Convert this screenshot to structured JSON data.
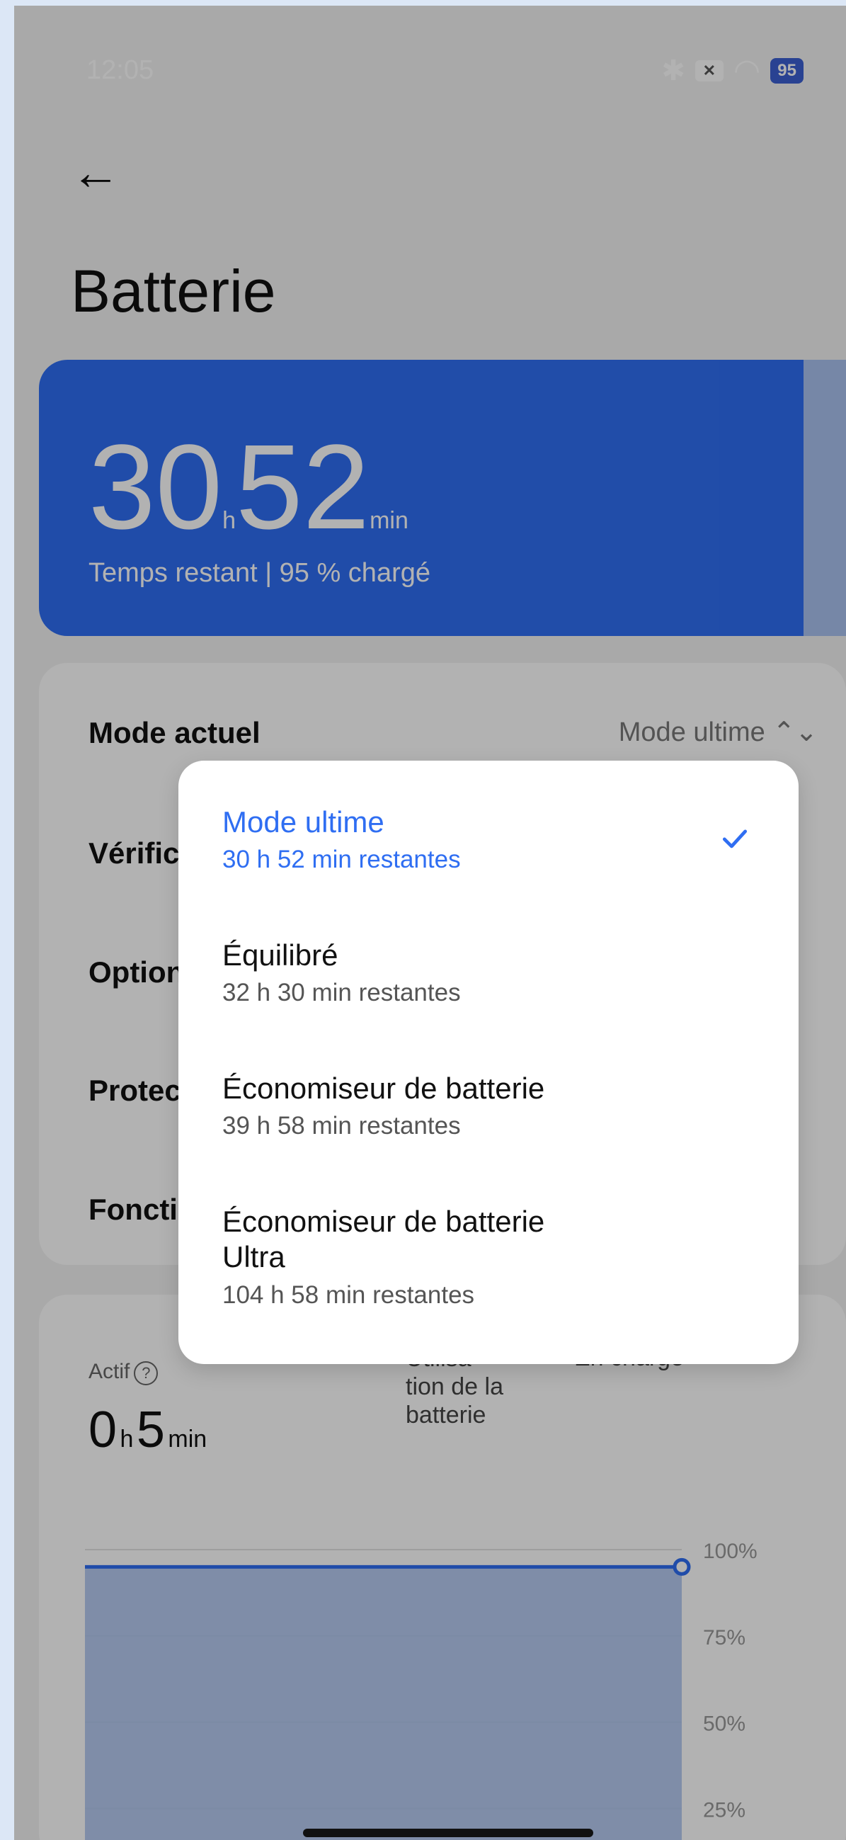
{
  "status_bar": {
    "time": "12:05",
    "battery_level": "95",
    "wifi_sub": "6"
  },
  "header": {
    "title": "Batterie"
  },
  "hero": {
    "hours": "30",
    "hours_unit": "h",
    "minutes": "52",
    "minutes_unit": "min",
    "subtitle": "Temps restant | 95 % chargé"
  },
  "settings": {
    "current_mode_label": "Mode actuel",
    "current_mode_value": "Mode ultime",
    "rows": [
      "Vérific",
      "Option",
      "Protec",
      "Foncti"
    ]
  },
  "usage": {
    "active_label": "Actif",
    "hours": "0",
    "hours_unit": "h",
    "minutes": "5",
    "minutes_unit": "min",
    "legend_usage": "Utilisa\ntion de la\nbatterie",
    "legend_charge": "En charge"
  },
  "chart_data": {
    "type": "area",
    "y_tick_labels": [
      "100%",
      "75%",
      "50%",
      "25%"
    ],
    "ylim": [
      0,
      100
    ],
    "series": [
      {
        "name": "Utilisation de la batterie",
        "values": [
          95,
          95
        ]
      }
    ],
    "colors": {
      "usage": "#2f6ef2",
      "charge": "#27a844"
    }
  },
  "dropdown": {
    "options": [
      {
        "title": "Mode ultime",
        "subtitle": "30 h 52 min restantes",
        "selected": true
      },
      {
        "title": "Équilibré",
        "subtitle": "32 h 30 min restantes",
        "selected": false
      },
      {
        "title": "Économiseur de batterie",
        "subtitle": "39 h 58 min restantes",
        "selected": false
      },
      {
        "title": "Économiseur de batterie\nUltra",
        "subtitle": "104 h 58 min restantes",
        "selected": false
      }
    ]
  }
}
